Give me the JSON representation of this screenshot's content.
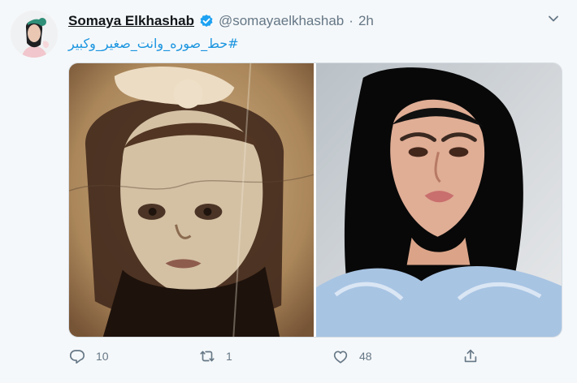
{
  "tweet": {
    "display_name": "Somaya Elkhashab",
    "handle": "@somayaelkhashab",
    "separator": "·",
    "time": "2h",
    "text": "#حط_صوره_وانت_صغير_وكبير"
  },
  "actions": {
    "reply_count": "10",
    "retweet_count": "1",
    "like_count": "48"
  },
  "colors": {
    "link": "#1b95e0",
    "verified": "#1da1f2",
    "icon": "#657786"
  },
  "icons": [
    "verified-badge-icon",
    "chevron-down-icon",
    "reply-icon",
    "retweet-icon",
    "like-icon",
    "share-icon"
  ]
}
